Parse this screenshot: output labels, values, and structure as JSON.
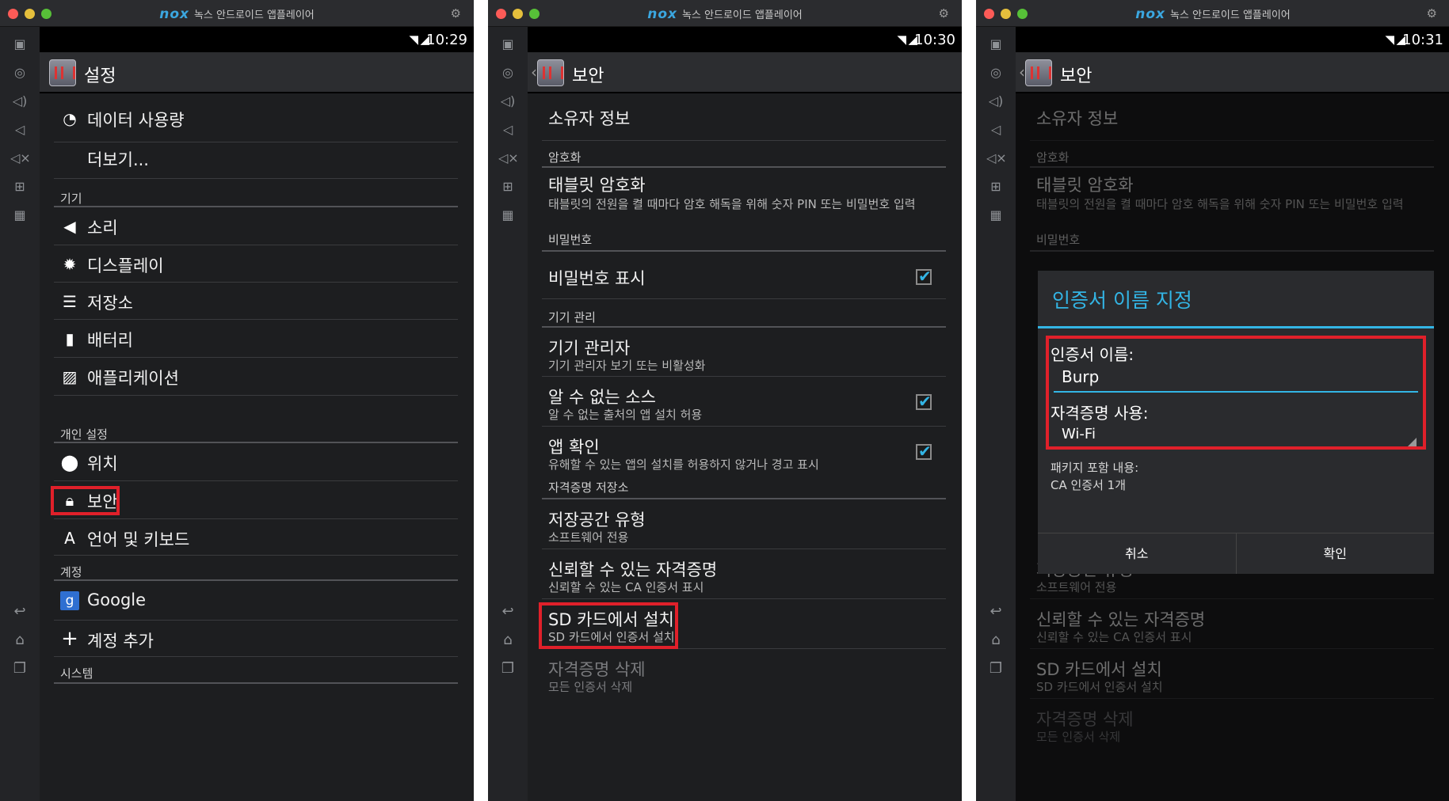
{
  "app": {
    "brand_logo": "nox",
    "brand_title": "녹스 안드로이드 앱플레이어"
  },
  "colors": {
    "accent": "#33b5e5",
    "highlight_box": "#e0202a",
    "background": "#1d1e20"
  },
  "icons": {
    "sidebar": [
      "robot-icon",
      "location-icon",
      "volume-up-icon",
      "volume-down-icon",
      "mute-icon",
      "apk-icon",
      "screenshot-icon"
    ],
    "nav": [
      "back-icon",
      "home-icon",
      "recent-apps-icon"
    ]
  },
  "panel1": {
    "time": "10:29",
    "title": "설정",
    "items_top": [
      {
        "label": "데이터 사용량",
        "icon": "data-usage-icon"
      },
      {
        "label": "더보기...",
        "icon": ""
      }
    ],
    "header_device": "기기",
    "device_items": [
      {
        "label": "소리",
        "icon": "speaker-icon"
      },
      {
        "label": "디스플레이",
        "icon": "display-icon"
      },
      {
        "label": "저장소",
        "icon": "storage-icon"
      },
      {
        "label": "배터리",
        "icon": "battery-icon"
      },
      {
        "label": "애플리케이션",
        "icon": "apps-icon"
      }
    ],
    "header_personal": "개인 설정",
    "personal_items": [
      {
        "label": "위치",
        "icon": "location-icon"
      },
      {
        "label": "보안",
        "icon": "lock-icon"
      },
      {
        "label": "언어 및 키보드",
        "icon": "keyboard-icon"
      }
    ],
    "header_accounts": "계정",
    "account_items": [
      {
        "label": "Google",
        "icon": "google-icon"
      },
      {
        "label": "계정 추가",
        "icon": "plus-icon"
      }
    ],
    "header_system": "시스템"
  },
  "panel2": {
    "time": "10:30",
    "title": "보안",
    "owner_info": "소유자 정보",
    "header_encryption": "암호화",
    "tablet_encrypt": {
      "title": "태블릿 암호화",
      "sub": "태블릿의 전원을 켤 때마다 암호 해독을 위해 숫자 PIN 또는 비밀번호 입력"
    },
    "header_password": "비밀번호",
    "show_password": {
      "title": "비밀번호 표시",
      "checked": true
    },
    "header_device_admin": "기기 관리",
    "device_admin": {
      "title": "기기 관리자",
      "sub": "기기 관리자 보기 또는 비활성화"
    },
    "unknown_sources": {
      "title": "알 수 없는 소스",
      "sub": "알 수 없는 출처의 앱 설치 허용",
      "checked": true
    },
    "verify_apps": {
      "title": "앱 확인",
      "sub": "유해할 수 있는 앱의 설치를 허용하지 않거나 경고 표시",
      "checked": true
    },
    "header_credential_storage": "자격증명 저장소",
    "storage_type": {
      "title": "저장공간 유형",
      "sub": "소프트웨어 전용"
    },
    "trusted_credentials": {
      "title": "신뢰할 수 있는 자격증명",
      "sub": "신뢰할 수 있는 CA 인증서 표시"
    },
    "install_sd": {
      "title": "SD 카드에서 설치",
      "sub": "SD 카드에서 인증서 설치"
    },
    "clear_credentials": {
      "title": "자격증명 삭제",
      "sub": "모든 인증서 삭제"
    }
  },
  "panel3": {
    "time": "10:31",
    "dialog": {
      "title": "인증서 이름 지정",
      "name_label": "인증서 이름:",
      "name_value": "Burp",
      "usage_label": "자격증명 사용:",
      "usage_value": "Wi-Fi",
      "package_label": "패키지 포함 내용:",
      "package_value": "CA 인증서 1개",
      "cancel": "취소",
      "ok": "확인"
    }
  }
}
